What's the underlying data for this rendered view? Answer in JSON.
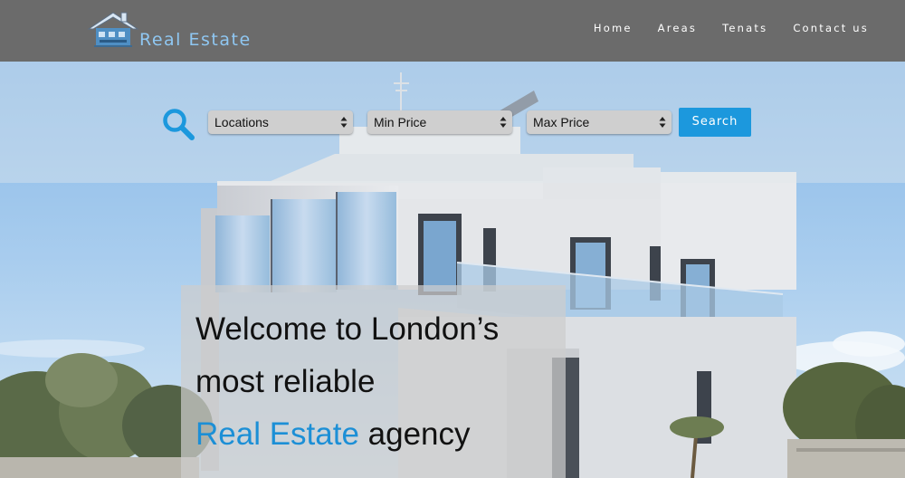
{
  "brand": {
    "name": "Real Estate",
    "logo_icon": "house-logo-icon"
  },
  "nav": {
    "items": [
      {
        "label": "Home"
      },
      {
        "label": "Areas"
      },
      {
        "label": "Tenats"
      },
      {
        "label": "Contact us"
      }
    ]
  },
  "search": {
    "icon": "magnifier-icon",
    "filters": [
      {
        "label": "Locations"
      },
      {
        "label": "Min Price"
      },
      {
        "label": "Max Price"
      }
    ],
    "button_label": "Search"
  },
  "hero": {
    "line1": "Welcome to London’s",
    "line2": "most reliable",
    "line3_accent": "Real Estate",
    "line3_rest": " agency"
  },
  "colors": {
    "header_bg": "#6b6b6b",
    "accent_blue": "#1c98dd",
    "logo_text": "#8fc7f2",
    "nav_text": "#ffffff"
  }
}
